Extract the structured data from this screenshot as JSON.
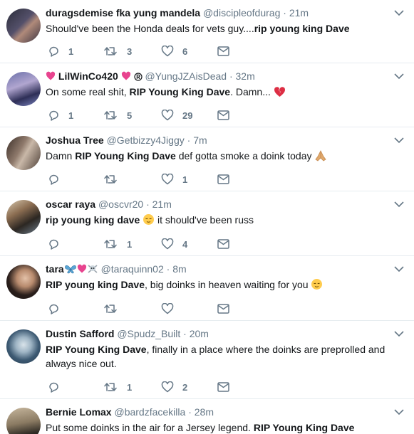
{
  "icons": {
    "reply": "reply-icon",
    "retweet": "retweet-icon",
    "like": "heart-icon",
    "dm": "envelope-icon",
    "more": "chevron-down-icon"
  },
  "tweets": [
    {
      "name": "duragsdemise fka yung mandela",
      "handle": "@discipleofdurag",
      "dot": "·",
      "time": "21m",
      "text_before": "Should've been the Honda deals for vets guy....",
      "text_bold": "rip young king Dave",
      "text_after": "",
      "replies": "1",
      "retweets": "3",
      "likes": "6"
    },
    {
      "name": "LilWinCo420",
      "handle": "@YungJZAisDead",
      "dot": "·",
      "time": "32m",
      "text_before": "On some real shit, ",
      "text_bold": "RIP Young King Dave",
      "text_after": ". Damn...",
      "replies": "1",
      "retweets": "5",
      "likes": "29"
    },
    {
      "name": "Joshua Tree",
      "handle": "@Getbizzy4Jiggy",
      "dot": "·",
      "time": "7m",
      "text_before": "Damn ",
      "text_bold": "RIP Young King Dave",
      "text_after": " def gotta smoke a doink today",
      "replies": "",
      "retweets": "",
      "likes": "1"
    },
    {
      "name": "oscar raya",
      "handle": "@oscvr20",
      "dot": "·",
      "time": "21m",
      "text_before": "",
      "text_bold": "rip young king dave",
      "text_after": " it should've been russ",
      "replies": "",
      "retweets": "1",
      "likes": "4"
    },
    {
      "name": "tara",
      "handle": "@taraquinn02",
      "dot": "·",
      "time": "8m",
      "text_before": "",
      "text_bold": "RIP young king Dave",
      "text_after": ", big doinks in heaven waiting for you",
      "replies": "",
      "retweets": "",
      "likes": ""
    },
    {
      "name": "Dustin Safford",
      "handle": "@Spudz_Built",
      "dot": "·",
      "time": "20m",
      "text_before": "",
      "text_bold": "RIP Young King Dave",
      "text_after": ", finally in a place where the doinks are preprolled and always nice out.",
      "replies": "",
      "retweets": "1",
      "likes": "2"
    },
    {
      "name": "Bernie Lomax",
      "handle": "@bardzfacekilla",
      "dot": "·",
      "time": "28m",
      "text_before": "Put some doinks in the air for a Jersey legend. ",
      "text_bold": "RIP Young King Dave",
      "text_after": "",
      "replies": "",
      "retweets": "",
      "likes": ""
    }
  ]
}
